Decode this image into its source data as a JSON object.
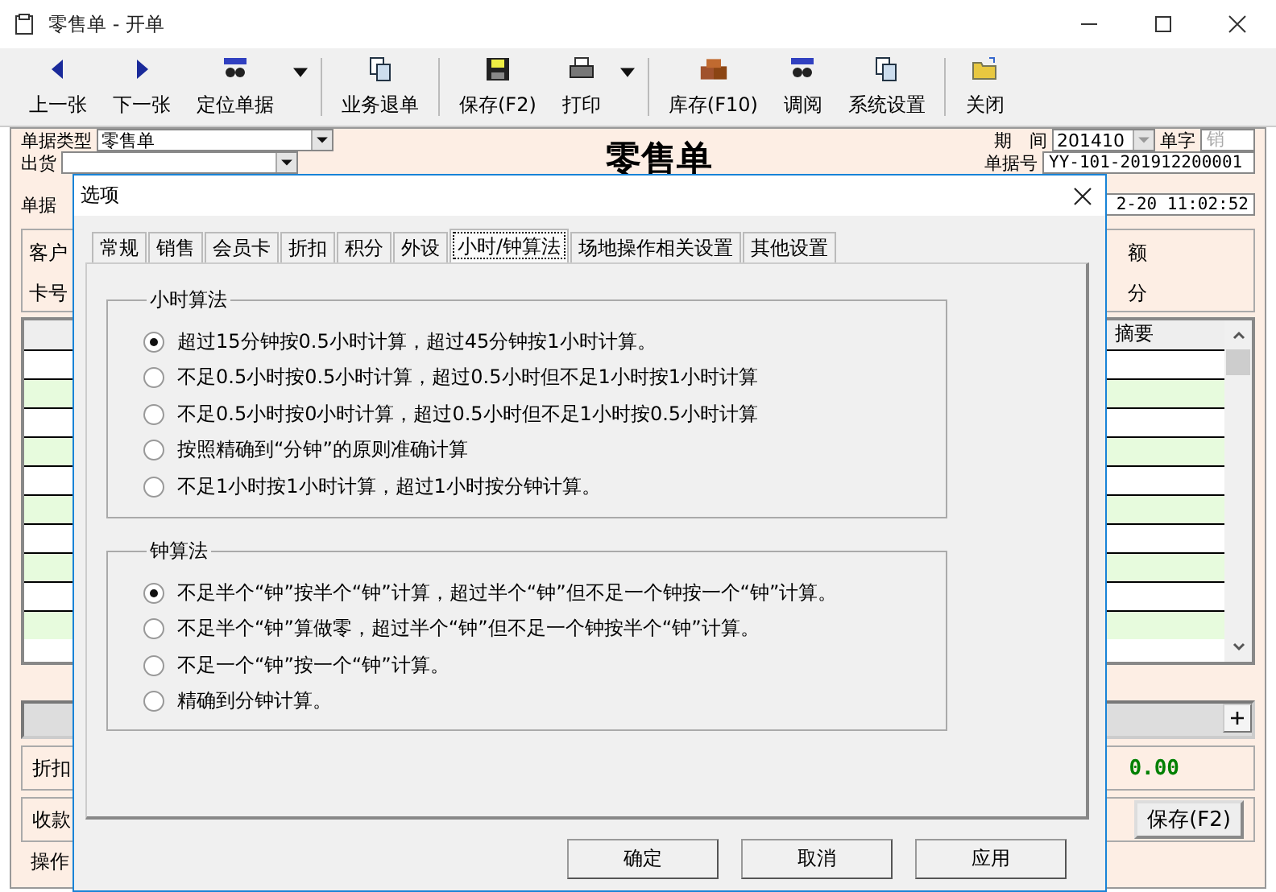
{
  "window": {
    "title": "零售单 - 开单"
  },
  "toolbar": {
    "groups": [
      [
        {
          "label": "上一张",
          "has_menu": false
        },
        {
          "label": "下一张",
          "has_menu": false
        },
        {
          "label": "定位单据",
          "has_menu": true
        }
      ],
      [
        {
          "label": "业务退单",
          "has_menu": false
        }
      ],
      [
        {
          "label": "保存(F2)",
          "has_menu": false
        },
        {
          "label": "打印",
          "has_menu": true
        }
      ],
      [
        {
          "label": "库存(F10)",
          "has_menu": false
        },
        {
          "label": "调阅",
          "has_menu": false
        },
        {
          "label": "系统设置",
          "has_menu": false
        }
      ],
      [
        {
          "label": "关闭",
          "has_menu": false
        }
      ]
    ]
  },
  "form": {
    "title": "零售单",
    "left_fields": [
      {
        "kind": "dropdown",
        "label": "单据类型",
        "value": "零售单"
      },
      {
        "kind": "dropdown",
        "label": "出货"
      },
      {
        "kind": "label",
        "label": "单据"
      }
    ],
    "period": {
      "label": "期　间",
      "value": "201410"
    },
    "prefix": {
      "label": "单字",
      "value": "销",
      "disabled": true
    },
    "number": {
      "label": "单据号",
      "value": "YY-101-201912200001"
    },
    "date": {
      "value": "2-20 11:02:52"
    },
    "customer_left": [
      "客户",
      "卡号"
    ],
    "customer_right": [
      "额",
      "分"
    ],
    "grid": {
      "header": "摘要"
    },
    "discount": {
      "label": "折扣",
      "amount": "0.00"
    },
    "payment": {
      "label": "收款",
      "save_button": "保存(F2)"
    },
    "operator": {
      "label": "操作"
    }
  },
  "dialog": {
    "title": "选项",
    "tabs": [
      {
        "label": "常规",
        "selected": false
      },
      {
        "label": "销售",
        "selected": false
      },
      {
        "label": "会员卡",
        "selected": false
      },
      {
        "label": "折扣",
        "selected": false
      },
      {
        "label": "积分",
        "selected": false
      },
      {
        "label": "外设",
        "selected": false
      },
      {
        "label": "小时/钟算法",
        "selected": true
      },
      {
        "label": "场地操作相关设置",
        "selected": false
      },
      {
        "label": "其他设置",
        "selected": false
      }
    ],
    "groups": [
      {
        "title": "小时算法",
        "options": [
          {
            "label": "超过15分钟按0.5小时计算，超过45分钟按1小时计算。",
            "selected": true
          },
          {
            "label": "不足0.5小时按0.5小时计算，超过0.5小时但不足1小时按1小时计算",
            "selected": false
          },
          {
            "label": "不足0.5小时按0小时计算，超过0.5小时但不足1小时按0.5小时计算",
            "selected": false
          },
          {
            "label": "按照精确到“分钟”的原则准确计算",
            "selected": false
          },
          {
            "label": "不足1小时按1小时计算，超过1小时按分钟计算。",
            "selected": false
          }
        ]
      },
      {
        "title": "钟算法",
        "options": [
          {
            "label": "不足半个“钟”按半个“钟”计算，超过半个“钟”但不足一个钟按一个“钟”计算。",
            "selected": true
          },
          {
            "label": "不足半个“钟”算做零，超过半个“钟”但不足一个钟按半个“钟”计算。",
            "selected": false
          },
          {
            "label": "不足一个“钟”按一个“钟”计算。",
            "selected": false
          },
          {
            "label": "精确到分钟计算。",
            "selected": false
          }
        ]
      }
    ],
    "buttons": [
      "确定",
      "取消",
      "应用"
    ]
  }
}
